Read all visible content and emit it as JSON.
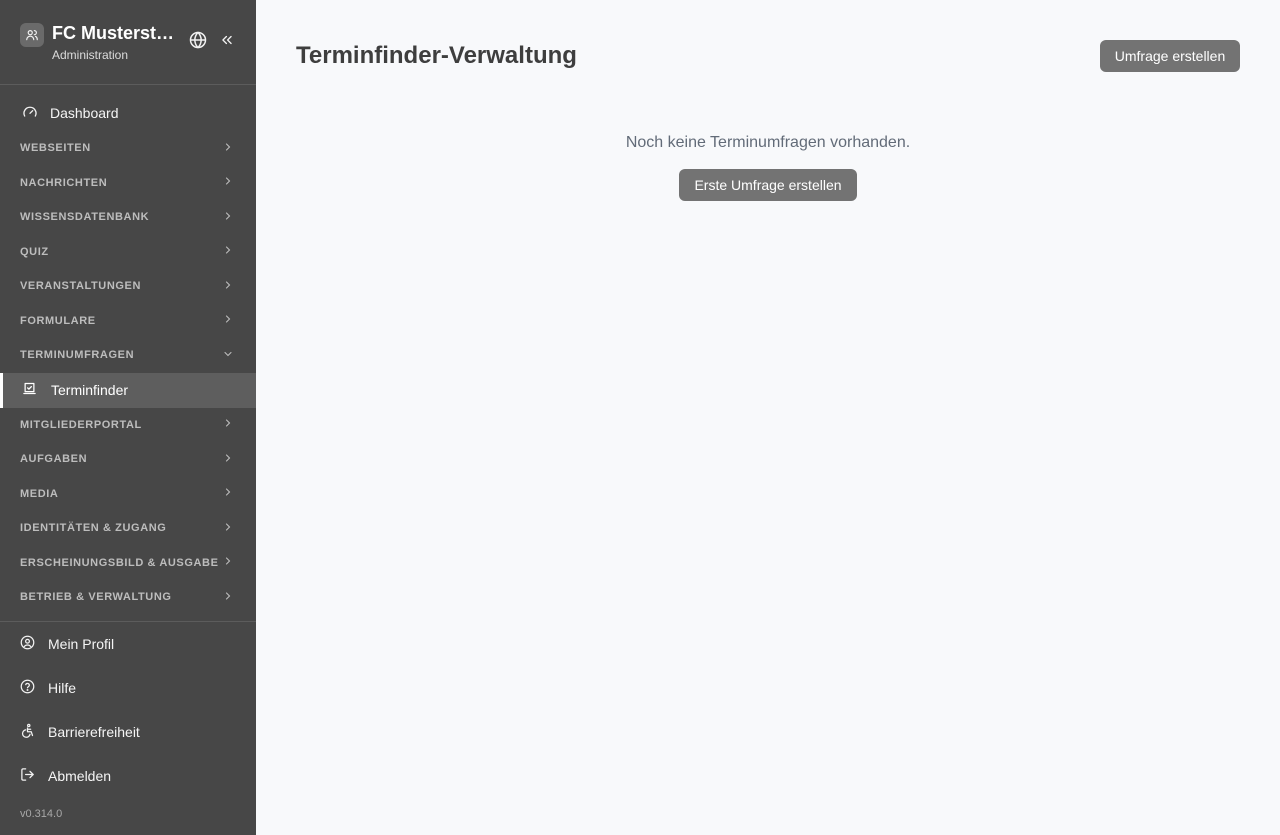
{
  "brand": {
    "title": "FC Musterst…",
    "subtitle": "Administration"
  },
  "icons": {
    "brand": "users-icon",
    "language": "globe-icon",
    "collapse": "chevrons-left-icon",
    "dashboard": "gauge-icon",
    "section_collapsed": "chevron-right-icon",
    "section_expanded": "chevron-down-icon",
    "terminfinder": "calendar-check-icon",
    "profile": "user-circle-icon",
    "help": "help-circle-icon",
    "accessibility": "accessibility-icon",
    "logout": "logout-icon"
  },
  "nav": {
    "dashboard": "Dashboard",
    "sections_before": [
      "WEBSEITEN",
      "NACHRICHTEN",
      "WISSENSDATENBANK",
      "QUIZ",
      "VERANSTALTUNGEN",
      "FORMULARE"
    ],
    "expanded_section": "TERMINUMFRAGEN",
    "active_item": "Terminfinder",
    "sections_after": [
      "MITGLIEDERPORTAL",
      "AUFGABEN",
      "MEDIA",
      "IDENTITÄTEN & ZUGANG",
      "ERSCHEINUNGSBILD & AUSGABE",
      "BETRIEB & VERWALTUNG"
    ]
  },
  "bottom": {
    "profile": "Mein Profil",
    "help": "Hilfe",
    "accessibility": "Barrierefreiheit",
    "logout": "Abmelden",
    "version": "v0.314.0"
  },
  "main": {
    "title": "Terminfinder-Verwaltung",
    "create_button": "Umfrage erstellen",
    "empty_text": "Noch keine Terminumfragen vorhanden.",
    "first_button": "Erste Umfrage erstellen"
  },
  "colors": {
    "sidebar_bg": "#474747",
    "active_bg": "#5e5e5e",
    "button_bg": "#737373",
    "page_bg": "#f8f9fb"
  }
}
